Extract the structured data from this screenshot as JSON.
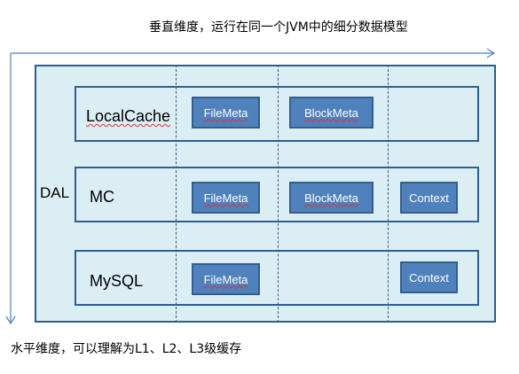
{
  "captions": {
    "vertical": "垂直维度，运行在同一个JVM中的细分数据模型",
    "horizontal": "水平维度，可以理解为L1、L2、L3级缓存"
  },
  "dal": {
    "label": "DAL"
  },
  "layers": [
    {
      "label": "LocalCache",
      "boxes": [
        "FileMeta",
        "BlockMeta"
      ]
    },
    {
      "label": "MC",
      "boxes": [
        "FileMeta",
        "BlockMeta",
        "Context"
      ]
    },
    {
      "label": "MySQL",
      "boxes": [
        "FileMeta",
        "Context"
      ]
    }
  ],
  "colors": {
    "container_fill": "#dbeef4",
    "border": "#2f5f91",
    "box_fill": "#4f81bd",
    "arrow": "#4f81bd"
  }
}
